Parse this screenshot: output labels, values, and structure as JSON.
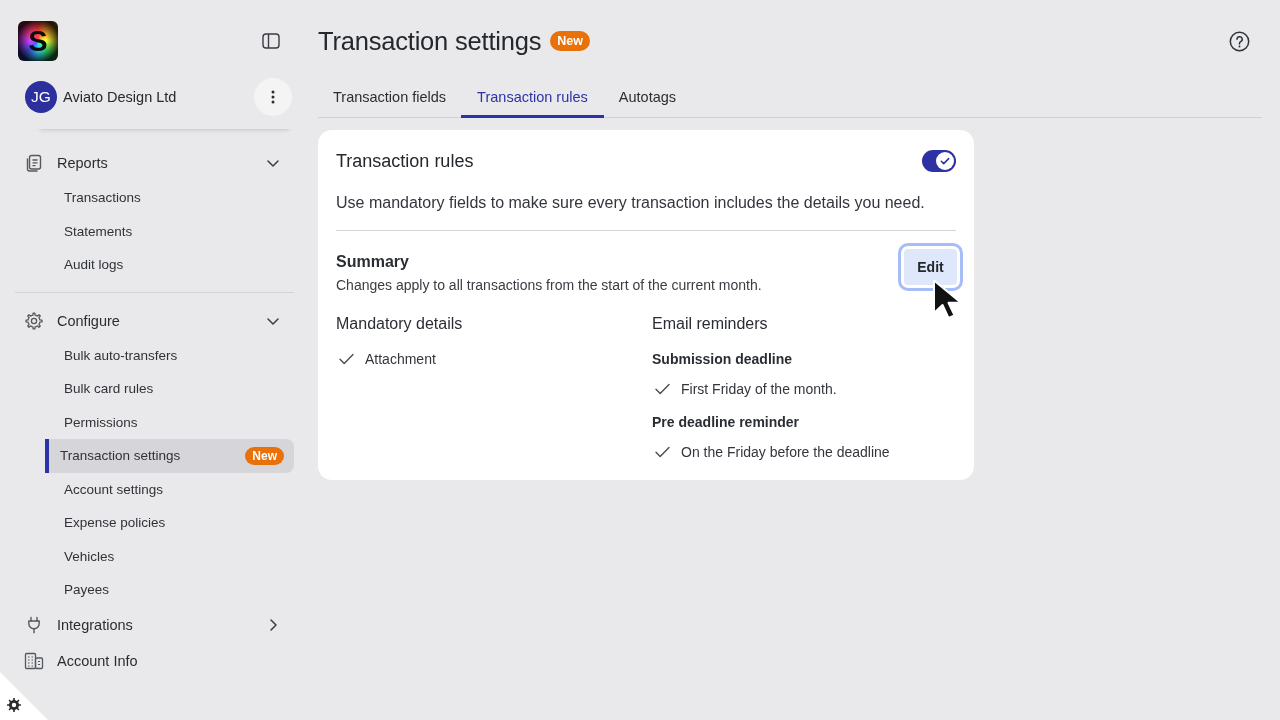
{
  "sidebar": {
    "logo": "S",
    "account": {
      "initials": "JG",
      "name": "Aviato Design Ltd"
    },
    "sections": [
      {
        "items": [
          {
            "kind": "group",
            "label": "Reports",
            "expanded": true,
            "children": [
              {
                "label": "Transactions",
                "selected": false
              },
              {
                "label": "Statements",
                "selected": false
              },
              {
                "label": "Audit logs",
                "selected": false
              }
            ]
          }
        ]
      },
      {
        "items": [
          {
            "kind": "group",
            "label": "Configure",
            "expanded": true,
            "children": [
              {
                "label": "Bulk auto-transfers",
                "selected": false
              },
              {
                "label": "Bulk card rules",
                "selected": false
              },
              {
                "label": "Permissions",
                "selected": false
              },
              {
                "label": "Transaction settings",
                "selected": true,
                "badge": "New"
              },
              {
                "label": "Account settings",
                "selected": false
              },
              {
                "label": "Expense policies",
                "selected": false
              },
              {
                "label": "Vehicles",
                "selected": false
              },
              {
                "label": "Payees",
                "selected": false
              }
            ]
          },
          {
            "kind": "group",
            "label": "Integrations",
            "expanded": false
          },
          {
            "kind": "link",
            "label": "Account Info"
          }
        ]
      }
    ]
  },
  "header": {
    "title": "Transaction settings",
    "badge": "New"
  },
  "tabs": [
    {
      "label": "Transaction fields",
      "selected": false
    },
    {
      "label": "Transaction rules",
      "selected": true
    },
    {
      "label": "Autotags",
      "selected": false
    }
  ],
  "card": {
    "title": "Transaction rules",
    "enabled": true,
    "description": "Use mandatory fields to make sure every transaction includes the details you need.",
    "summary": {
      "title": "Summary",
      "text": "Changes apply to all transactions from the start of the current month.",
      "edit_button": {
        "label": "Edit",
        "focused": true
      }
    },
    "columns": [
      {
        "title": "Mandatory details",
        "groups": [
          {
            "items": [
              "Attachment"
            ]
          }
        ]
      },
      {
        "title": "Email reminders",
        "groups": [
          {
            "heading": "Submission deadline",
            "items": [
              "First Friday of the month."
            ]
          },
          {
            "heading": "Pre deadline reminder",
            "items": [
              "On the Friday before the deadline"
            ]
          }
        ]
      }
    ]
  }
}
